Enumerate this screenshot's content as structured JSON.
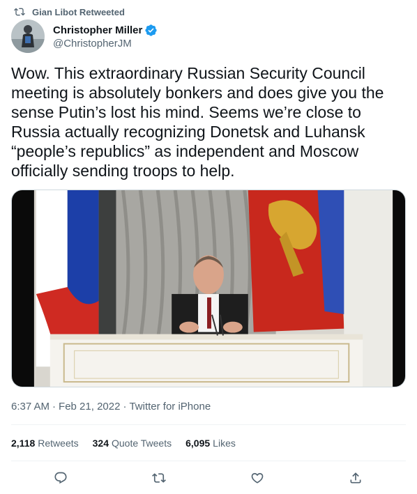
{
  "retweet": {
    "label": "Gian Libot Retweeted",
    "icon": "retweet-icon"
  },
  "author": {
    "display_name": "Christopher Miller",
    "handle": "@ChristopherJM",
    "verified_color": "#1d9bf0"
  },
  "tweet": {
    "text": "Wow. This extraordinary Russian Security Council meeting is absolutely bonkers and does give you the sense Putin’s lost his mind. Seems we’re close to Russia actually recognizing Donetsk and Luhansk “people’s republics” as independent and Moscow officially sending troops to help."
  },
  "meta": {
    "time": "6:37 AM",
    "sep1": "·",
    "date": "Feb 21, 2022",
    "sep2": "·",
    "source": "Twitter for iPhone"
  },
  "stats": {
    "retweets": {
      "count": "2,118",
      "label": "Retweets"
    },
    "quotes": {
      "count": "324",
      "label": "Quote Tweets"
    },
    "likes": {
      "count": "6,095",
      "label": "Likes"
    }
  },
  "actions": [
    "reply-icon",
    "retweet-icon",
    "like-icon",
    "share-icon"
  ],
  "colors": {
    "text": "#0f1419",
    "secondary": "#536471",
    "divider": "#eff3f4"
  }
}
